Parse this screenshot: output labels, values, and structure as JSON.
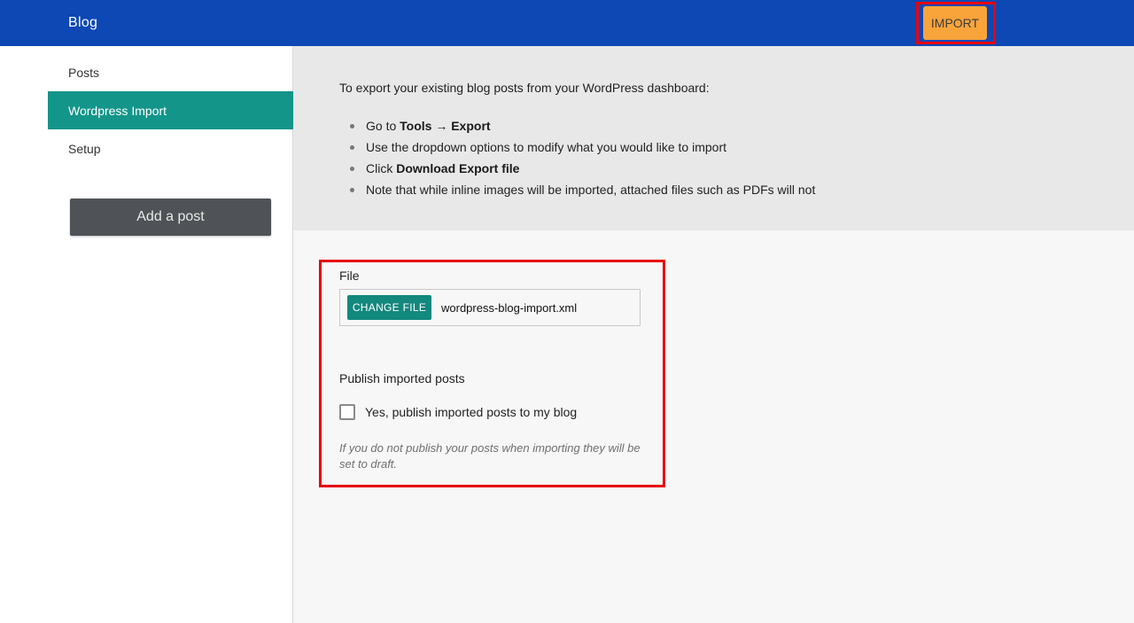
{
  "header": {
    "title": "Blog",
    "import_label": "IMPORT",
    "bg_color": "#0d48b5",
    "import_color": "#f9a43a"
  },
  "sidebar": {
    "items": [
      {
        "label": "Posts",
        "active": false
      },
      {
        "label": "Wordpress Import",
        "active": true
      },
      {
        "label": "Setup",
        "active": false
      }
    ],
    "add_post_label": "Add a post",
    "active_color": "#13958a"
  },
  "instructions": {
    "intro": "To export your existing blog posts from your WordPress dashboard:",
    "steps": [
      {
        "prefix": "Go to ",
        "bold1": "Tools",
        "mid": " → ",
        "bold2": "Export"
      },
      {
        "text": "Use the dropdown options to modify what you would like to import"
      },
      {
        "prefix": "Click ",
        "bold": "Download Export file"
      },
      {
        "text": "Note that while inline images will be imported, attached files such as PDFs will not"
      }
    ]
  },
  "form": {
    "file_label": "File",
    "change_file_label": "CHANGE FILE",
    "file_name": "wordpress-blog-import.xml",
    "publish_label": "Publish imported posts",
    "checkbox_label": "Yes, publish imported posts to my blog",
    "checkbox_checked": false,
    "help_text": "If you do not publish your posts when importing they will be set to draft."
  }
}
